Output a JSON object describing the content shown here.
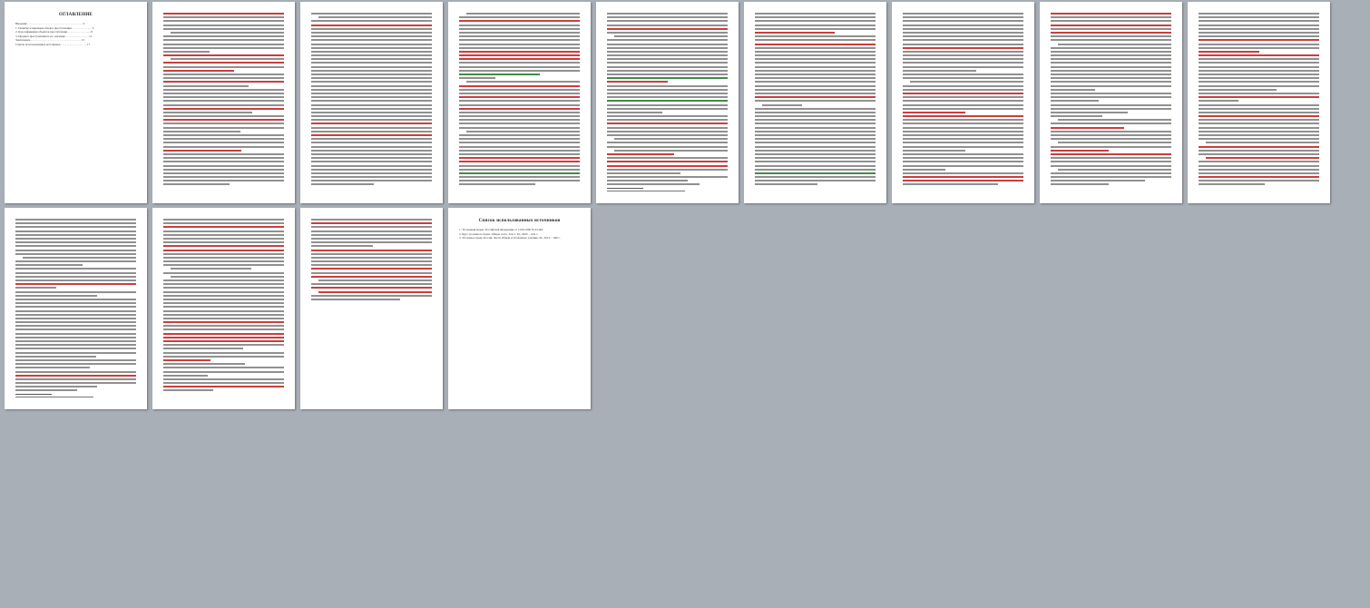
{
  "document": {
    "toc_page": {
      "heading": "ОГЛАВЛЕНИЕ",
      "entries": [
        "Введение . . . . . . . . . . . . . . . . . . . . . . . . . . . . . . . . . . . . . . 3",
        "1. Понятие и признаки объекта преступления . . . . . . . . . . . . . . 5",
        "2. Классификация объектов преступления . . . . . . . . . . . . . . . . 8",
        "3. Предмет преступления и его значение . . . . . . . . . . . . . . . . 11",
        "Заключение . . . . . . . . . . . . . . . . . . . . . . . . . . . . . . . . . . . 15",
        "Список использованных источников . . . . . . . . . . . . . . . . . . 17"
      ]
    },
    "references_page": {
      "heading": "Список использованных источников",
      "entries": [
        "1. Уголовный кодекс Российской Федерации от 13.06.1996 № 63-ФЗ.",
        "2. Курс уголовного права. Общая часть. Том 1. М., 2002. – 624 с.",
        "3. Уголовное право России. Части Общая и Особенная: учебник. М., 2013. – 840 с."
      ]
    }
  }
}
